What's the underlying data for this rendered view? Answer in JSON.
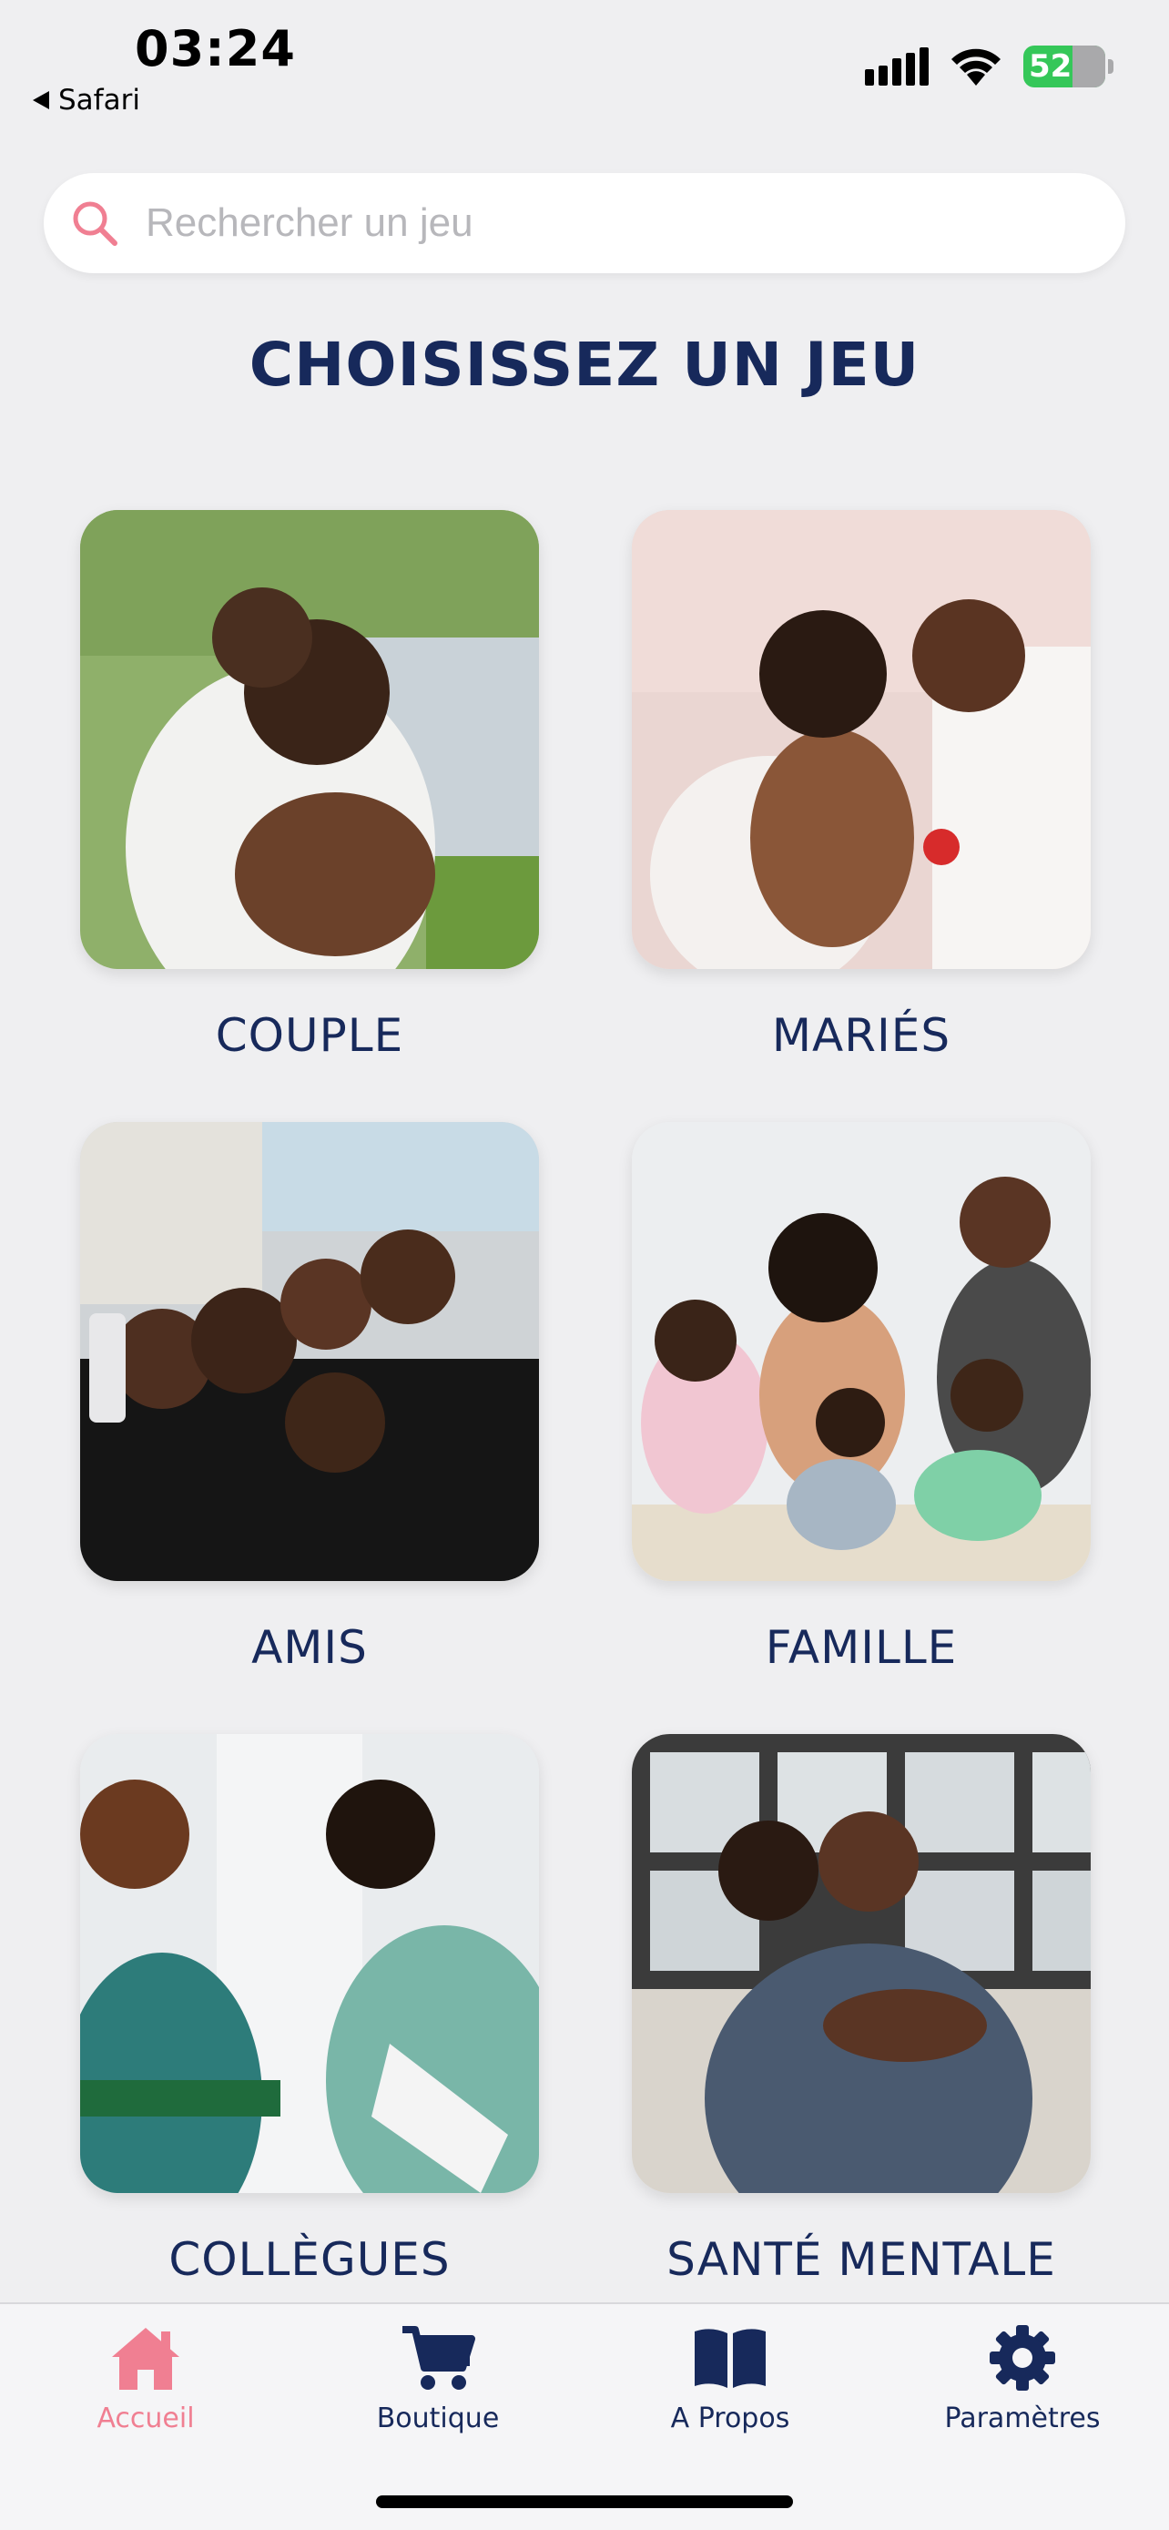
{
  "status_bar": {
    "time": "03:24",
    "back_label": "Safari",
    "battery": "52",
    "icons": [
      "cellular-signal-icon",
      "wifi-icon",
      "battery-charging-icon"
    ]
  },
  "search": {
    "placeholder": "Rechercher un jeu",
    "value": ""
  },
  "page_title": "CHOISISSEZ UN JEU",
  "games": [
    {
      "label": "COUPLE",
      "image": "couple-embracing-photo"
    },
    {
      "label": "MARIÉS",
      "image": "wedding-couple-photo"
    },
    {
      "label": "AMIS",
      "image": "friends-group-photo"
    },
    {
      "label": "FAMILLE",
      "image": "family-group-photo"
    },
    {
      "label": "COLLÈGUES",
      "image": "colleagues-talking-photo"
    },
    {
      "label": "SANTÉ MENTALE",
      "image": "two-men-hugging-photo"
    }
  ],
  "tabbar": {
    "items": [
      {
        "label": "Accueil",
        "icon": "home-icon",
        "active": true
      },
      {
        "label": "Boutique",
        "icon": "cart-icon",
        "active": false
      },
      {
        "label": "A Propos",
        "icon": "book-icon",
        "active": false
      },
      {
        "label": "Paramètres",
        "icon": "gear-icon",
        "active": false
      }
    ]
  },
  "colors": {
    "accent": "#f07f92",
    "navy": "#17295b",
    "background": "#efeff1"
  }
}
